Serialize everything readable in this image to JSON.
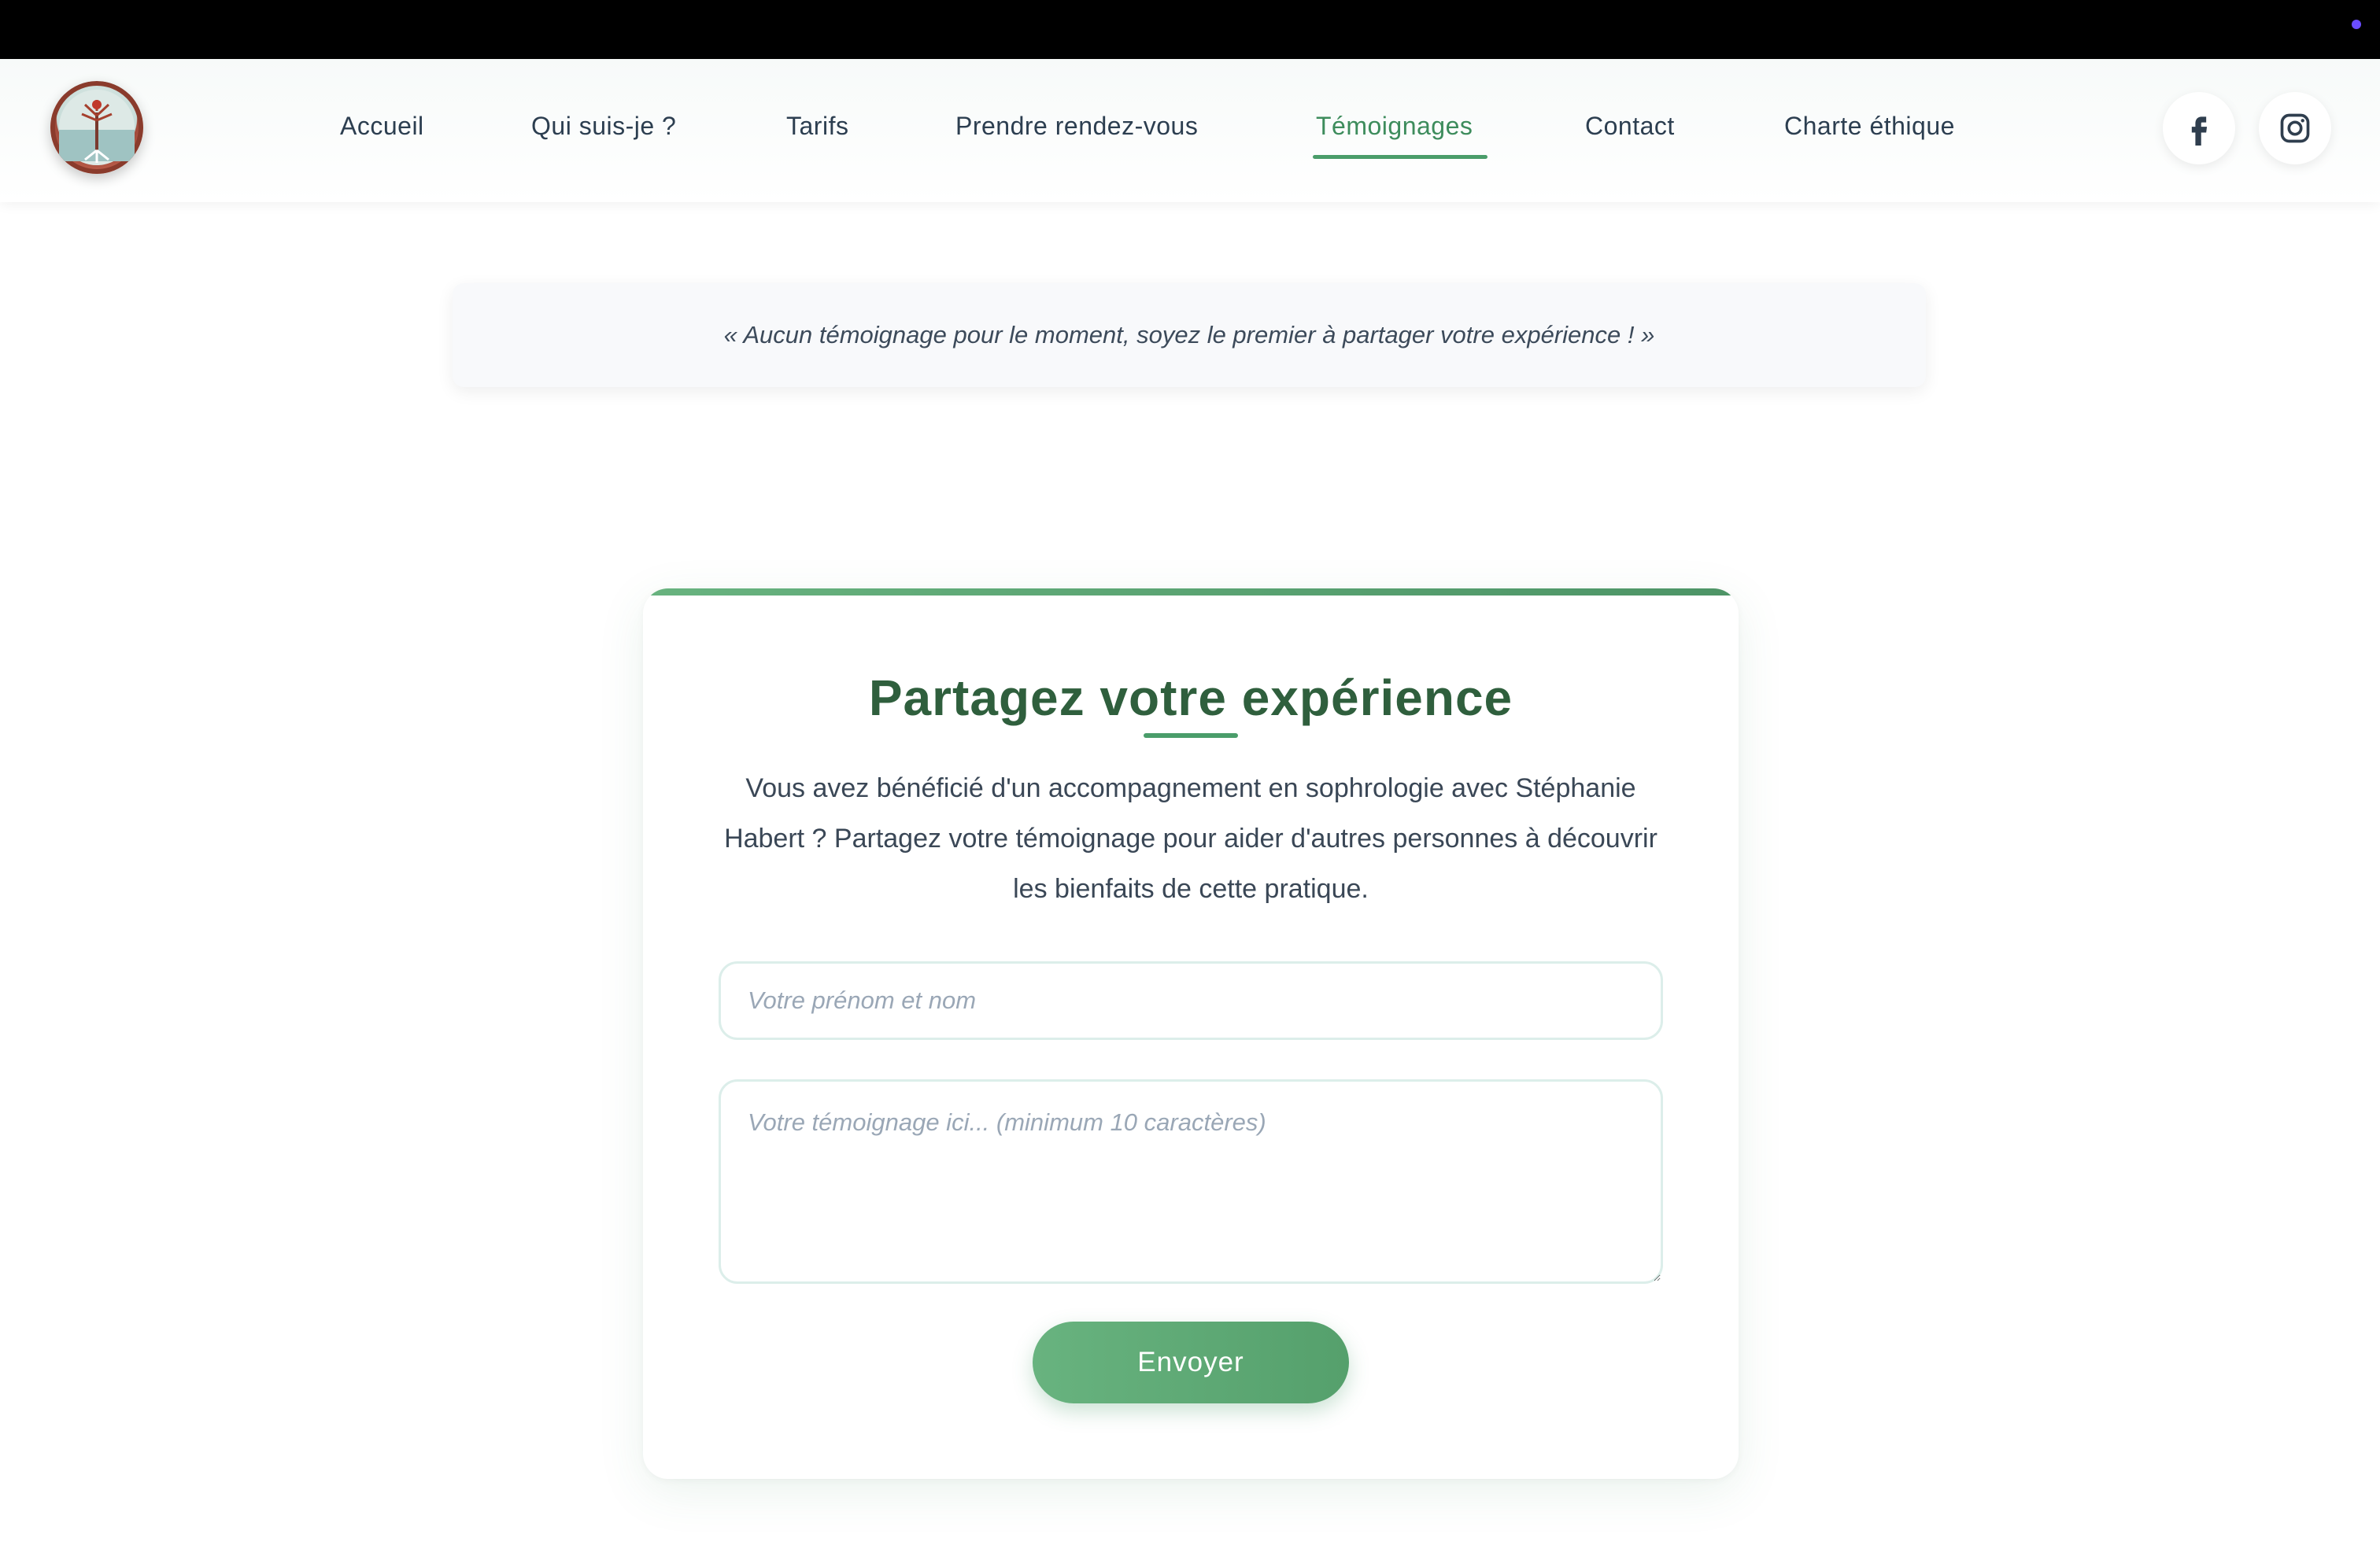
{
  "nav": {
    "links": [
      {
        "label": "Accueil"
      },
      {
        "label": "Qui suis-je ?"
      },
      {
        "label": "Tarifs"
      },
      {
        "label": "Prendre rendez-vous"
      },
      {
        "label": "Témoignages"
      },
      {
        "label": "Contact"
      },
      {
        "label": "Charte éthique"
      }
    ],
    "active": "Témoignages",
    "social": [
      "facebook-icon",
      "instagram-icon"
    ]
  },
  "testimonials": {
    "empty_message": "« Aucun témoignage pour le moment, soyez le premier à partager votre expérience ! »"
  },
  "form": {
    "title": "Partagez votre expérience",
    "description": "Vous avez bénéficié d'un accompagnement en sophrologie avec Stéphanie Habert ? Partagez votre témoignage pour aider d'autres personnes à découvrir les bienfaits de cette pratique.",
    "name_placeholder": "Votre prénom et nom",
    "name_value": "",
    "message_placeholder": "Votre témoignage ici... (minimum 10 caractères)",
    "message_value": "",
    "submit_label": "Envoyer"
  },
  "colors": {
    "accent": "#4a9d6a",
    "title": "#2f5f3d",
    "topbar": "#000000"
  }
}
